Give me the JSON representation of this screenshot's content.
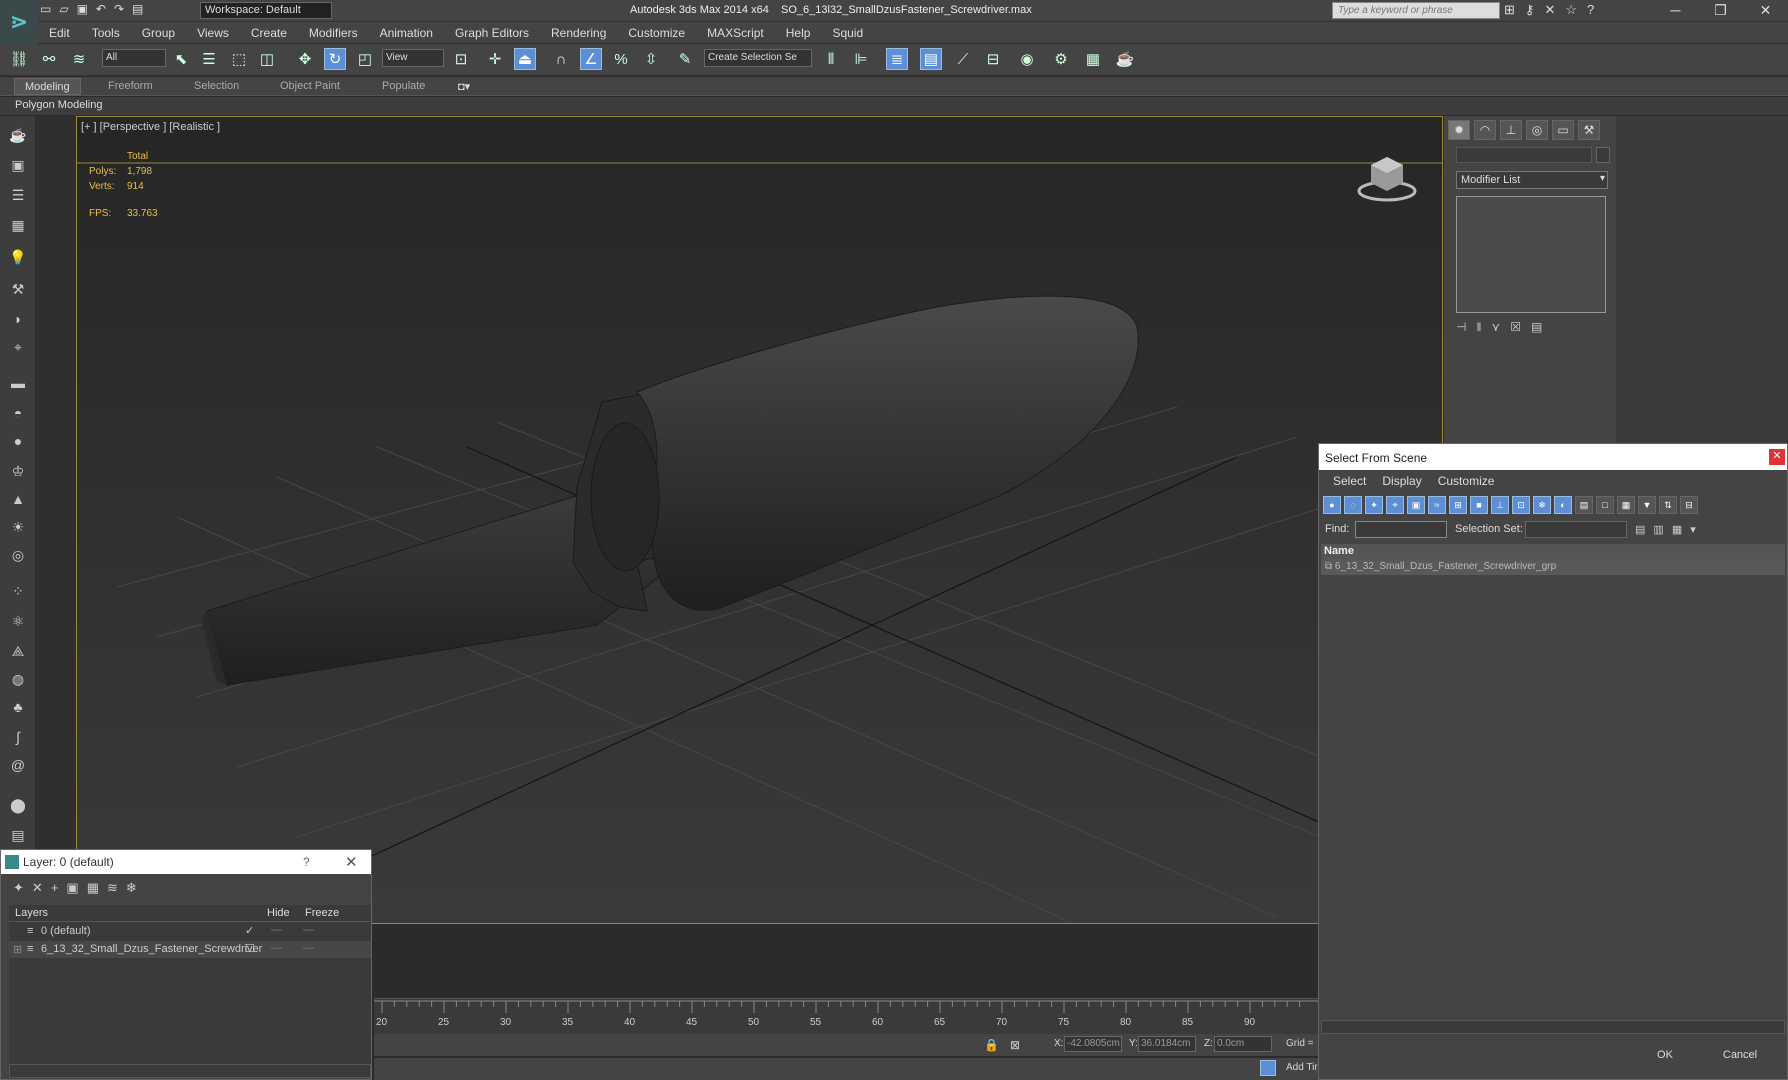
{
  "titlebar": {
    "app": "Autodesk 3ds Max  2014 x64",
    "file": "SO_6_13l32_SmallDzusFastener_Screwdriver.max",
    "workspace": "Workspace: Default",
    "search_placeholder": "Type a keyword or phrase"
  },
  "menu": [
    "Edit",
    "Tools",
    "Group",
    "Views",
    "Create",
    "Modifiers",
    "Animation",
    "Graph Editors",
    "Rendering",
    "Customize",
    "MAXScript",
    "Help",
    "Squid"
  ],
  "toolbar": {
    "filter": "All",
    "refcoord": "View",
    "selection_set": "Create Selection Se"
  },
  "ribbon": {
    "tabs": [
      "Modeling",
      "Freeform",
      "Selection",
      "Object Paint",
      "Populate"
    ],
    "active": "Modeling",
    "panel": "Polygon Modeling"
  },
  "viewport": {
    "label": "[+ ] [Perspective ] [Realistic ]",
    "stats_header": "Total",
    "polys_label": "Polys:",
    "polys": "1,798",
    "verts_label": "Verts:",
    "verts": "914",
    "fps_label": "FPS:",
    "fps": "33.763"
  },
  "cmdpanel": {
    "modifier_list": "Modifier List"
  },
  "select_from_scene": {
    "title": "Select From Scene",
    "menu": [
      "Select",
      "Display",
      "Customize"
    ],
    "find_label": "Find:",
    "selset_label": "Selection Set:",
    "col_name": "Name",
    "row": "6_13_32_Small_Dzus_Fastener_Screwdriver_grp",
    "ok": "OK",
    "cancel": "Cancel"
  },
  "layer_dialog": {
    "title": "Layer: 0 (default)",
    "help": "?",
    "col_layers": "Layers",
    "col_hide": "Hide",
    "col_freeze": "Freeze",
    "rows": [
      "0 (default)",
      "6_13_32_Small_Dzus_Fastener_Screwdriver"
    ]
  },
  "timeline": {
    "ticks": [
      "20",
      "25",
      "30",
      "35",
      "40",
      "45",
      "50",
      "55",
      "60",
      "65",
      "70",
      "75",
      "80",
      "85",
      "90"
    ]
  },
  "status": {
    "x_label": "X:",
    "x": "-42.0805cm",
    "y_label": "Y:",
    "y": "36.0184cm",
    "z_label": "Z:",
    "z": "0.0cm",
    "grid": "Grid =",
    "addtime": "Add Tir"
  },
  "colors": {
    "viewport_border": "#9a8a3a",
    "stats": "#e8c040",
    "active_button": "#5c8fd6"
  }
}
